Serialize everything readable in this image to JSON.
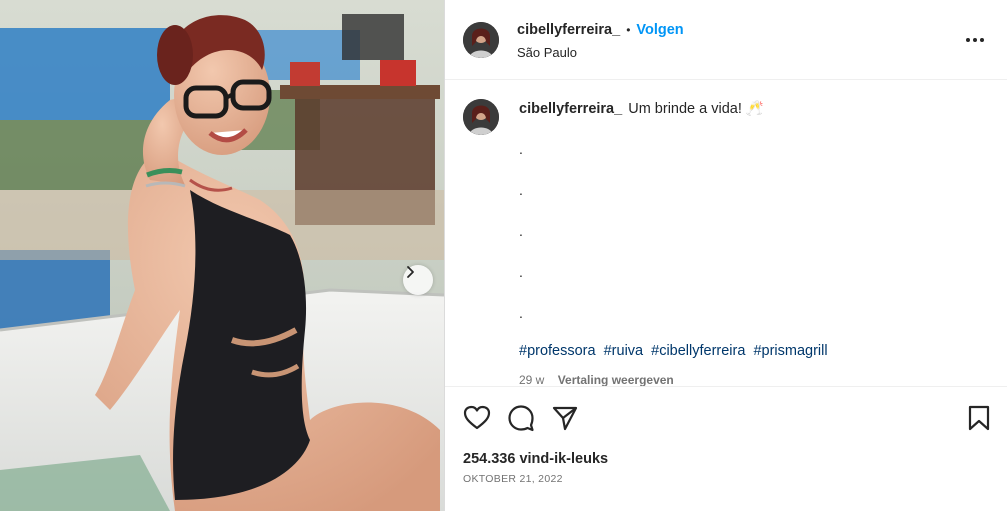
{
  "post": {
    "username": "cibellyferreira_",
    "follow_label": "Volgen",
    "separator": "•",
    "location": "São Paulo",
    "more_label": "Meer opties"
  },
  "caption": {
    "username": "cibellyferreira_",
    "text": "Um brinde a vida! 🥂",
    "dots": [
      ".",
      ".",
      ".",
      ".",
      "."
    ],
    "hashtags": [
      "#professora",
      "#ruiva",
      "#cibellyferreira",
      "#prismagrill"
    ],
    "age": "29 w",
    "translate_label": "Vertaling weergeven"
  },
  "actions": {
    "like_icon": "heart-icon",
    "comment_icon": "comment-icon",
    "share_icon": "share-icon",
    "save_icon": "bookmark-icon"
  },
  "stats": {
    "likes": "254.336 vind-ik-leuks",
    "date": "OKTOBER 21, 2022"
  },
  "colors": {
    "accent": "#0095f6",
    "hashtag": "#00376b",
    "muted": "#737373",
    "text": "#262626"
  }
}
